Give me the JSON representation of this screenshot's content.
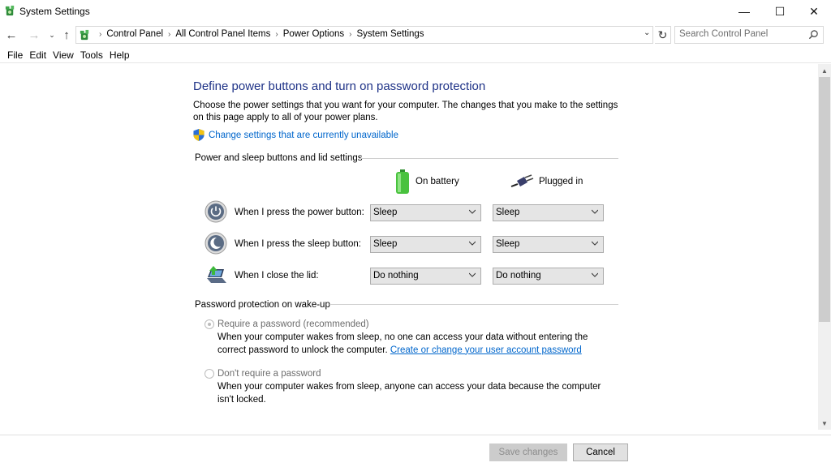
{
  "window": {
    "title": "System Settings",
    "controls": {
      "minimize": "—",
      "maximize": "☐",
      "close": "✕"
    }
  },
  "nav": {
    "back": "←",
    "forward": "→",
    "recent": "⌄",
    "up": "↑",
    "refresh": "↻",
    "address_dropdown": "⌄"
  },
  "breadcrumb": [
    "Control Panel",
    "All Control Panel Items",
    "Power Options",
    "System Settings"
  ],
  "search": {
    "placeholder": "Search Control Panel"
  },
  "menu": [
    "File",
    "Edit",
    "View",
    "Tools",
    "Help"
  ],
  "page": {
    "title": "Define power buttons and turn on password protection",
    "description": "Choose the power settings that you want for your computer. The changes that you make to the settings on this page apply to all of your power plans.",
    "change_link": "Change settings that are currently unavailable",
    "section_buttons": "Power and sleep buttons and lid settings",
    "col_battery": "On battery",
    "col_plugged": "Plugged in",
    "rows": [
      {
        "label": "When I press the power button:",
        "battery": "Sleep",
        "plugged": "Sleep",
        "icon": "power-button-icon"
      },
      {
        "label": "When I press the sleep button:",
        "battery": "Sleep",
        "plugged": "Sleep",
        "icon": "sleep-button-icon"
      },
      {
        "label": "When I close the lid:",
        "battery": "Do nothing",
        "plugged": "Do nothing",
        "icon": "laptop-lid-icon"
      }
    ],
    "section_password": "Password protection on wake-up",
    "require_password": {
      "label": "Require a password (recommended)",
      "checked": true,
      "desc": "When your computer wakes from sleep, no one can access your data without entering the correct password to unlock the computer.",
      "link": "Create or change your user account password"
    },
    "no_password": {
      "label": "Don't require a password",
      "checked": false,
      "desc": "When your computer wakes from sleep, anyone can access your data because the computer isn't locked."
    }
  },
  "footer": {
    "save": "Save changes",
    "cancel": "Cancel"
  },
  "colors": {
    "title_blue": "#1e3287",
    "link_blue": "#0066cc"
  }
}
